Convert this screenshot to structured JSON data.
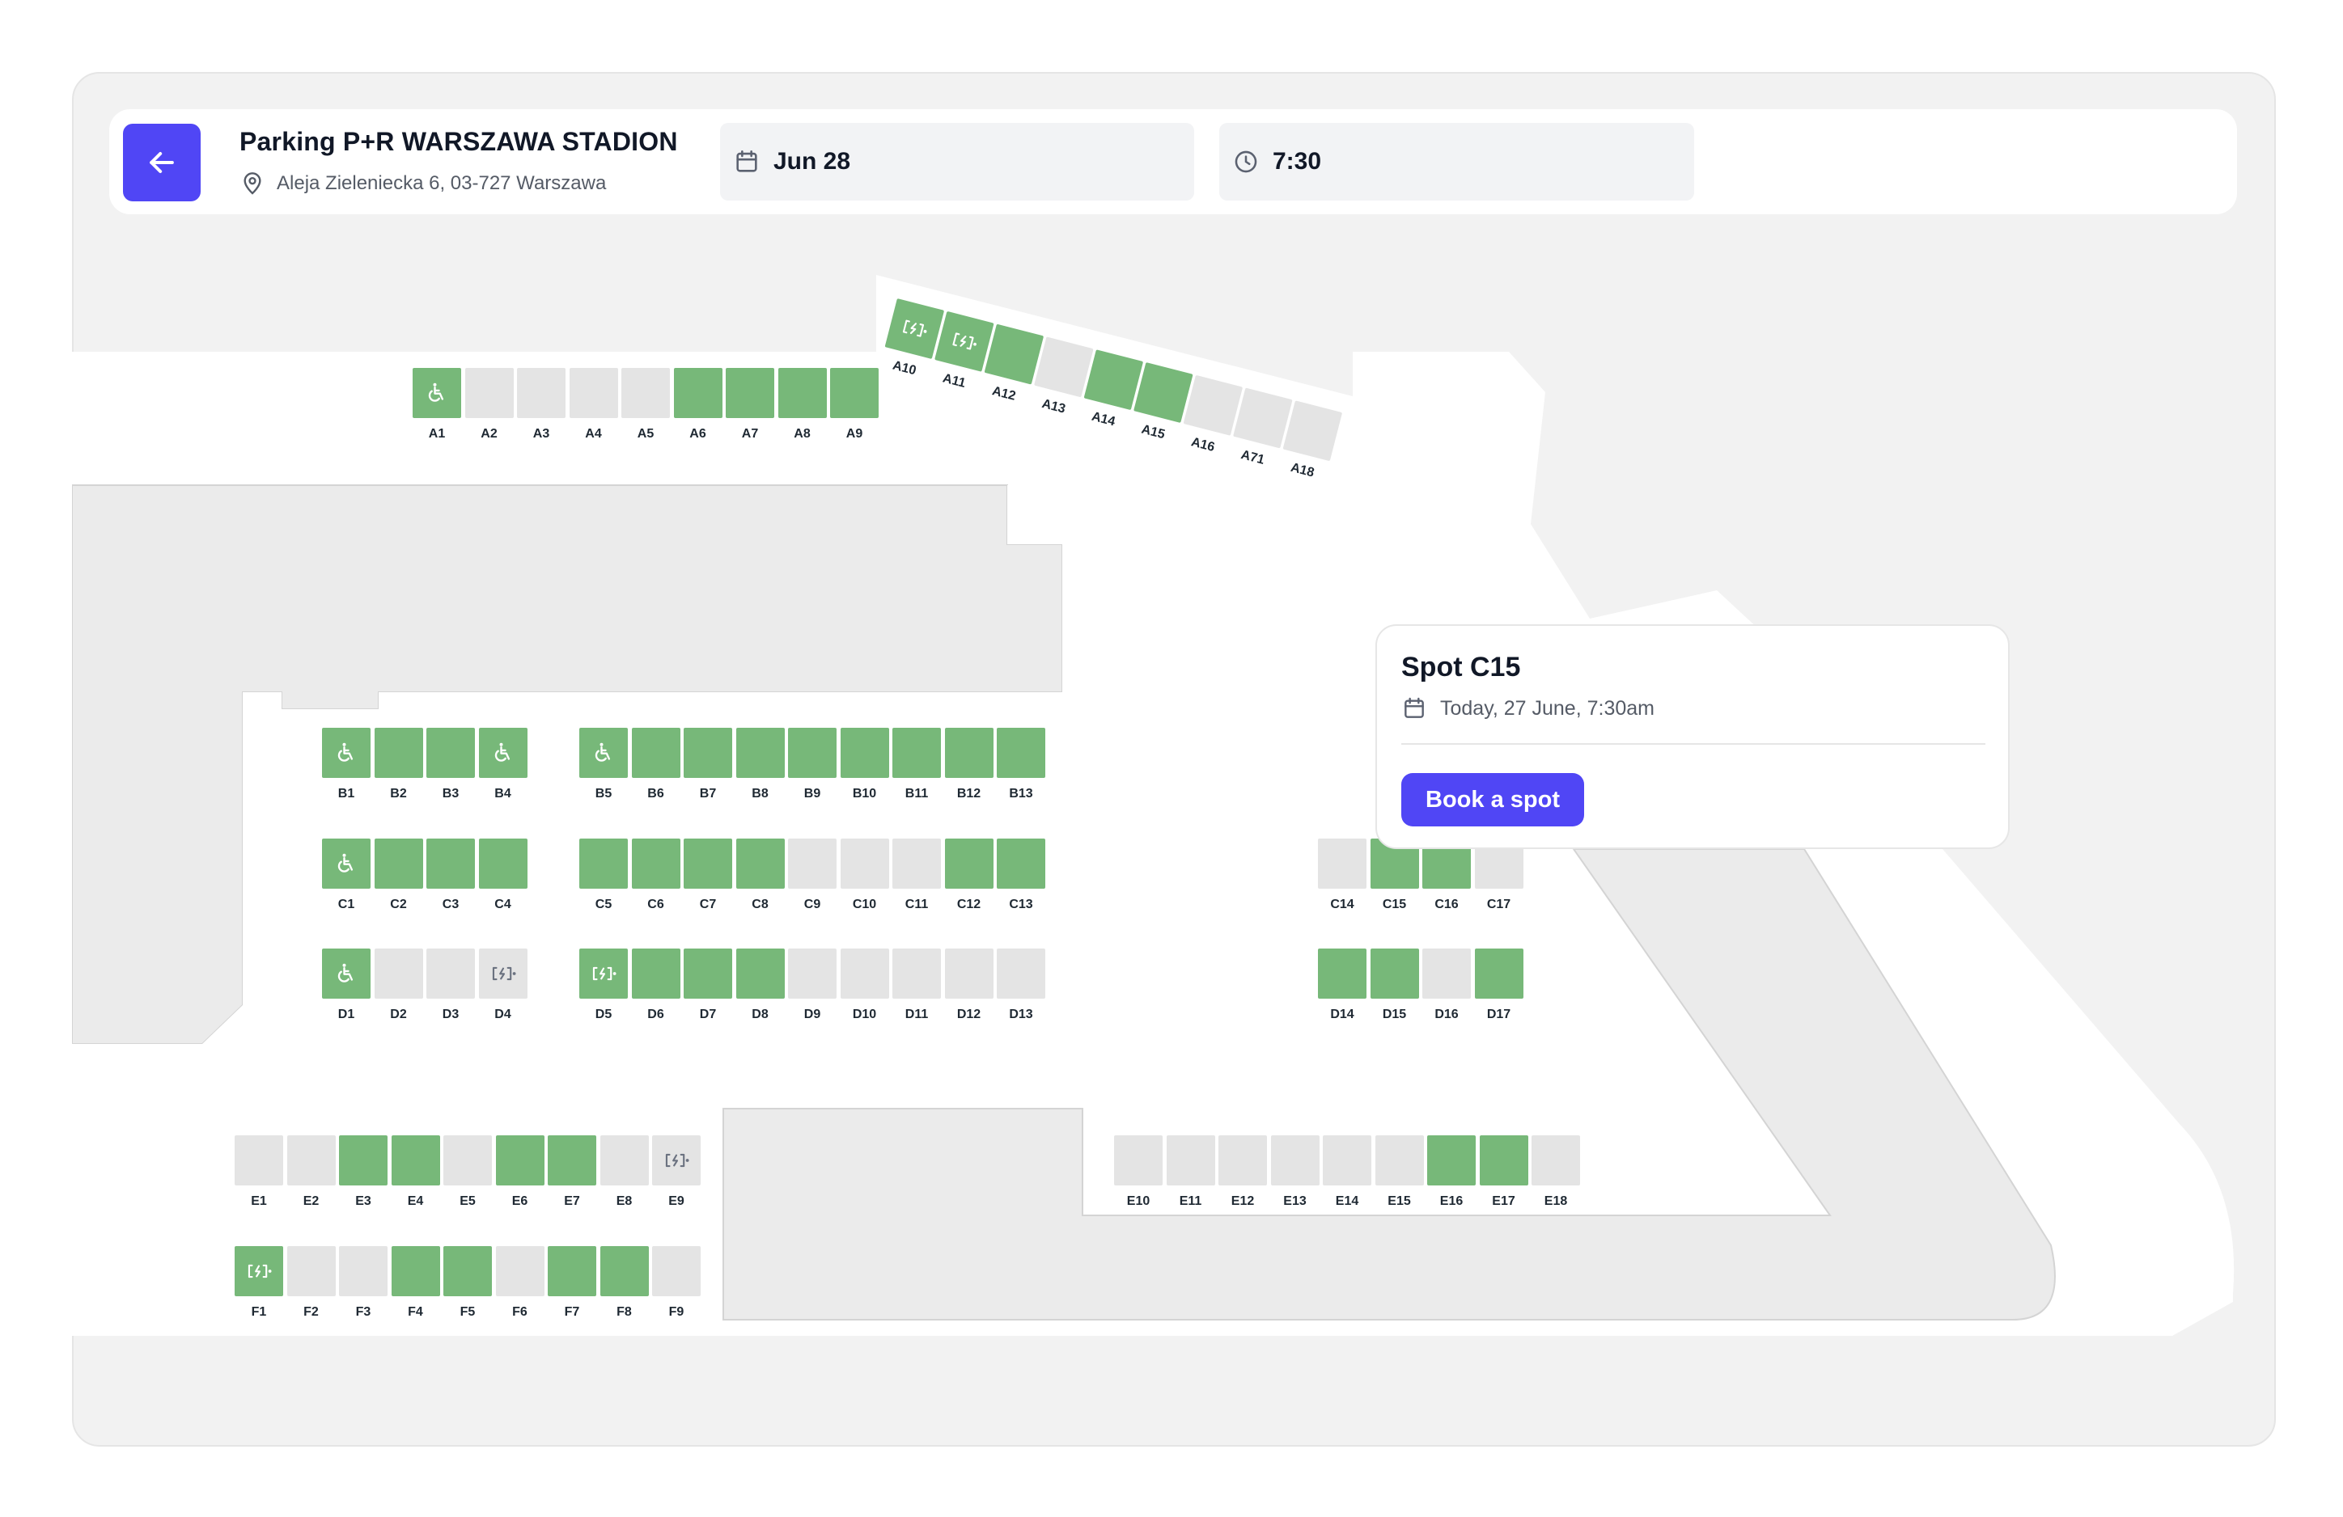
{
  "header": {
    "back_label": "Back",
    "lot_name": "Parking P+R WARSZAWA STADION",
    "address": "Aleja Zieleniecka 6, 03-727 Warszawa",
    "date": "Jun 28",
    "time": "7:30"
  },
  "popup": {
    "title": "Spot C15",
    "datetime": "Today, 27 June, 7:30am",
    "button_label": "Book a spot"
  },
  "colors": {
    "accent": "#5046f5",
    "spot_free": "#77b879",
    "spot_occupied": "#e4e4e4",
    "map_background": "#f2f2f2",
    "road": "#ffffff",
    "building": "#ebebeb"
  },
  "legend": {
    "free": "green",
    "occupied": "gray",
    "accessible_icon": "wheelchair-icon",
    "ev_icon": "ev-charger-icon"
  },
  "spots": {
    "A": [
      {
        "id": "A1",
        "status": "free",
        "icon": "accessible"
      },
      {
        "id": "A2",
        "status": "occupied"
      },
      {
        "id": "A3",
        "status": "occupied"
      },
      {
        "id": "A4",
        "status": "occupied"
      },
      {
        "id": "A5",
        "status": "occupied"
      },
      {
        "id": "A6",
        "status": "free"
      },
      {
        "id": "A7",
        "status": "free"
      },
      {
        "id": "A8",
        "status": "free"
      },
      {
        "id": "A9",
        "status": "free"
      }
    ],
    "A_angled": [
      {
        "id": "A10",
        "status": "free",
        "icon": "ev"
      },
      {
        "id": "A11",
        "status": "free",
        "icon": "ev"
      },
      {
        "id": "A12",
        "status": "free"
      },
      {
        "id": "A13",
        "status": "occupied"
      },
      {
        "id": "A14",
        "status": "free"
      },
      {
        "id": "A15",
        "status": "free"
      },
      {
        "id": "A16",
        "status": "occupied"
      },
      {
        "id": "A71",
        "status": "occupied"
      },
      {
        "id": "A18",
        "status": "occupied"
      }
    ],
    "B_left": [
      {
        "id": "B1",
        "status": "free",
        "icon": "accessible"
      },
      {
        "id": "B2",
        "status": "free"
      },
      {
        "id": "B3",
        "status": "free"
      },
      {
        "id": "B4",
        "status": "free",
        "icon": "accessible"
      }
    ],
    "B_right": [
      {
        "id": "B5",
        "status": "free",
        "icon": "accessible"
      },
      {
        "id": "B6",
        "status": "free"
      },
      {
        "id": "B7",
        "status": "free"
      },
      {
        "id": "B8",
        "status": "free"
      },
      {
        "id": "B9",
        "status": "free"
      },
      {
        "id": "B10",
        "status": "free"
      },
      {
        "id": "B11",
        "status": "free"
      },
      {
        "id": "B12",
        "status": "free"
      },
      {
        "id": "B13",
        "status": "free"
      }
    ],
    "C_left": [
      {
        "id": "C1",
        "status": "free",
        "icon": "accessible"
      },
      {
        "id": "C2",
        "status": "free"
      },
      {
        "id": "C3",
        "status": "free"
      },
      {
        "id": "C4",
        "status": "free"
      }
    ],
    "C_right": [
      {
        "id": "C5",
        "status": "free"
      },
      {
        "id": "C6",
        "status": "free"
      },
      {
        "id": "C7",
        "status": "free"
      },
      {
        "id": "C8",
        "status": "free"
      },
      {
        "id": "C9",
        "status": "occupied"
      },
      {
        "id": "C10",
        "status": "occupied"
      },
      {
        "id": "C11",
        "status": "occupied"
      },
      {
        "id": "C12",
        "status": "free"
      },
      {
        "id": "C13",
        "status": "free"
      }
    ],
    "C_far": [
      {
        "id": "C14",
        "status": "occupied"
      },
      {
        "id": "C15",
        "status": "free"
      },
      {
        "id": "C16",
        "status": "free"
      },
      {
        "id": "C17",
        "status": "occupied"
      }
    ],
    "D_left": [
      {
        "id": "D1",
        "status": "free",
        "icon": "accessible"
      },
      {
        "id": "D2",
        "status": "occupied"
      },
      {
        "id": "D3",
        "status": "occupied"
      },
      {
        "id": "D4",
        "status": "occupied",
        "icon": "ev"
      }
    ],
    "D_right": [
      {
        "id": "D5",
        "status": "free",
        "icon": "ev"
      },
      {
        "id": "D6",
        "status": "free"
      },
      {
        "id": "D7",
        "status": "free"
      },
      {
        "id": "D8",
        "status": "free"
      },
      {
        "id": "D9",
        "status": "occupied"
      },
      {
        "id": "D10",
        "status": "occupied"
      },
      {
        "id": "D11",
        "status": "occupied"
      },
      {
        "id": "D12",
        "status": "occupied"
      },
      {
        "id": "D13",
        "status": "occupied"
      }
    ],
    "D_far": [
      {
        "id": "D14",
        "status": "free"
      },
      {
        "id": "D15",
        "status": "free"
      },
      {
        "id": "D16",
        "status": "occupied"
      },
      {
        "id": "D17",
        "status": "free"
      }
    ],
    "E_left": [
      {
        "id": "E1",
        "status": "occupied"
      },
      {
        "id": "E2",
        "status": "occupied"
      },
      {
        "id": "E3",
        "status": "free"
      },
      {
        "id": "E4",
        "status": "free"
      },
      {
        "id": "E5",
        "status": "occupied"
      },
      {
        "id": "E6",
        "status": "free"
      },
      {
        "id": "E7",
        "status": "free"
      },
      {
        "id": "E8",
        "status": "occupied"
      },
      {
        "id": "E9",
        "status": "occupied",
        "icon": "ev"
      }
    ],
    "E_right": [
      {
        "id": "E10",
        "status": "occupied"
      },
      {
        "id": "E11",
        "status": "occupied"
      },
      {
        "id": "E12",
        "status": "occupied"
      },
      {
        "id": "E13",
        "status": "occupied"
      },
      {
        "id": "E14",
        "status": "occupied"
      },
      {
        "id": "E15",
        "status": "occupied"
      },
      {
        "id": "E16",
        "status": "free"
      },
      {
        "id": "E17",
        "status": "free"
      },
      {
        "id": "E18",
        "status": "occupied"
      }
    ],
    "F": [
      {
        "id": "F1",
        "status": "free",
        "icon": "ev"
      },
      {
        "id": "F2",
        "status": "occupied"
      },
      {
        "id": "F3",
        "status": "occupied"
      },
      {
        "id": "F4",
        "status": "free"
      },
      {
        "id": "F5",
        "status": "free"
      },
      {
        "id": "F6",
        "status": "occupied"
      },
      {
        "id": "F7",
        "status": "free"
      },
      {
        "id": "F8",
        "status": "free"
      },
      {
        "id": "F9",
        "status": "occupied"
      }
    ]
  }
}
